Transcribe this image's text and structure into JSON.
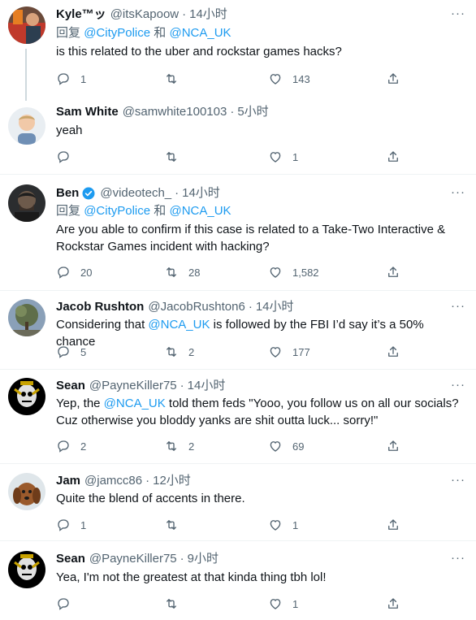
{
  "reply_to_label": "回复",
  "and_label": "和",
  "mention_city": "@CityPolice",
  "mention_nca": "@NCA_UK",
  "tweets": [
    {
      "name": "Kyle™ッ",
      "handle": "@itsKapoow",
      "time": "14小时",
      "text": "is this related to the uber and rockstar games hacks?",
      "replies": "1",
      "retweets": "",
      "likes": "143"
    },
    {
      "name": "Sam White",
      "handle": "@samwhite100103",
      "time": "5小时",
      "text": "yeah",
      "replies": "",
      "retweets": "",
      "likes": "1"
    },
    {
      "name": "Ben",
      "handle": "@videotech_",
      "time": "14小时",
      "text": "Are you able to confirm if this case is related to a Take-Two Interactive & Rockstar Games incident with hacking?",
      "replies": "20",
      "retweets": "28",
      "likes": "1,582"
    },
    {
      "name": "Jacob Rushton",
      "handle": "@JacobRushton6",
      "time": "14小时",
      "text_pre": "Considering that ",
      "text_post": " is followed by the FBI I’d say it’s a 50% chance",
      "replies": "5",
      "retweets": "2",
      "likes": "177"
    },
    {
      "name": "Sean",
      "handle": "@PayneKiller75",
      "time": "14小时",
      "text_pre": "Yep, the ",
      "text_post": " told them feds \"Yooo, you follow us on all our socials? Cuz otherwise you bloddy yanks are shit outta luck... sorry!\"",
      "replies": "2",
      "retweets": "2",
      "likes": "69"
    },
    {
      "name": "Jam",
      "handle": "@jamcc86",
      "time": "12小时",
      "text": "Quite the blend of accents in there.",
      "replies": "1",
      "retweets": "",
      "likes": "1"
    },
    {
      "name": "Sean",
      "handle": "@PayneKiller75",
      "time": "9小时",
      "text": "Yea, I'm not the greatest at that kinda thing tbh lol!",
      "replies": "",
      "retweets": "",
      "likes": "1"
    }
  ],
  "colors": {
    "accent": "#1d9bf0",
    "secondary_text": "#536471",
    "thread_line": "#cfd9de"
  },
  "icons": [
    "reply-icon",
    "retweet-icon",
    "like-icon",
    "share-icon",
    "more-icon",
    "verified-badge-icon"
  ]
}
